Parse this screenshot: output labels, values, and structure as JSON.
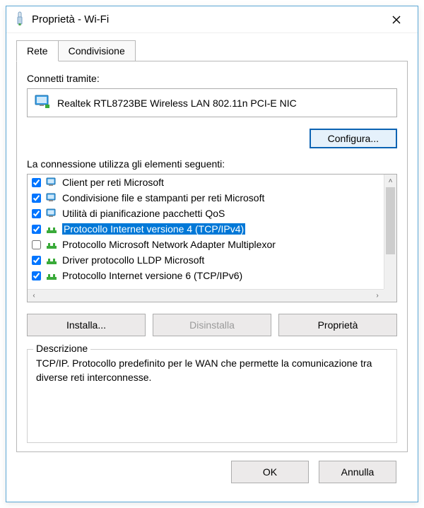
{
  "title": "Proprietà - Wi-Fi",
  "tabs": {
    "rete": "Rete",
    "condivisione": "Condivisione"
  },
  "connect_label": "Connetti tramite:",
  "nic_name": "Realtek RTL8723BE Wireless LAN 802.11n PCI-E NIC",
  "configure_btn": "Configura...",
  "elements_label": "La connessione utilizza gli elementi seguenti:",
  "items": [
    {
      "checked": true,
      "icon": "client",
      "text": "Client per reti Microsoft",
      "selected": false
    },
    {
      "checked": true,
      "icon": "client",
      "text": "Condivisione file e stampanti per reti Microsoft",
      "selected": false
    },
    {
      "checked": true,
      "icon": "client",
      "text": "Utilità di pianificazione pacchetti QoS",
      "selected": false
    },
    {
      "checked": true,
      "icon": "proto",
      "text": "Protocollo Internet versione 4 (TCP/IPv4)",
      "selected": true
    },
    {
      "checked": false,
      "icon": "proto",
      "text": "Protocollo Microsoft Network Adapter Multiplexor",
      "selected": false
    },
    {
      "checked": true,
      "icon": "proto",
      "text": "Driver protocollo LLDP Microsoft",
      "selected": false
    },
    {
      "checked": true,
      "icon": "proto",
      "text": "Protocollo Internet versione 6 (TCP/IPv6)",
      "selected": false
    }
  ],
  "install_btn": "Installa...",
  "uninstall_btn": "Disinstalla",
  "properties_btn": "Proprietà",
  "description_legend": "Descrizione",
  "description_text": "TCP/IP. Protocollo predefinito per le WAN che permette la comunicazione tra diverse reti interconnesse.",
  "ok_btn": "OK",
  "cancel_btn": "Annulla"
}
